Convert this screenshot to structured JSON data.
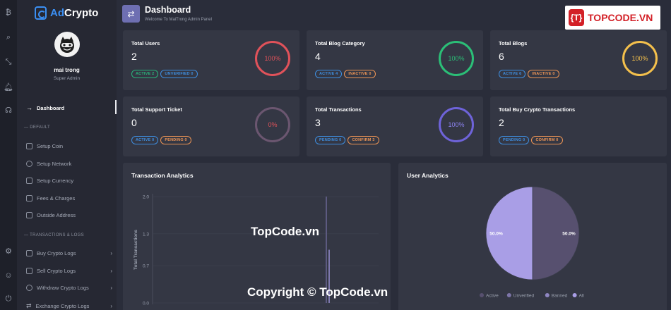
{
  "app": {
    "brand_prefix": "Ad",
    "brand_suffix": "Crypto"
  },
  "user": {
    "name": "mai trong",
    "role": "Super Admin"
  },
  "iconbar": [
    "crypto-icon",
    "search-icon",
    "compress-icon",
    "bell-icon",
    "headset-icon",
    "settings-icon",
    "user-icon",
    "power-icon"
  ],
  "nav": {
    "dashboard": "Dashboard",
    "section_default": "— DEFAULT",
    "default_items": [
      "Setup Coin",
      "Setup Network",
      "Setup Currency",
      "Fees & Charges",
      "Outside Address"
    ],
    "section_transactions": "— TRANSACTIONS & LOGS",
    "transaction_items": [
      "Buy Crypto Logs",
      "Sell Crypto Logs",
      "Withdraw Crypto Logs",
      "Exchange Crypto Logs"
    ]
  },
  "header": {
    "title": "Dashboard",
    "subtitle": "Welcome To MaiTrong Admin Panel"
  },
  "watermark": {
    "badge": "{T}",
    "text": "TOPCODE.VN",
    "center": "TopCode.vn",
    "bottom": "Copyright © TopCode.vn"
  },
  "cards": [
    {
      "title": "Total Users",
      "value": "2",
      "badges": [
        {
          "label": "ACTIVE 2",
          "style": "g"
        },
        {
          "label": "UNVERIFIED 0",
          "style": "b"
        }
      ],
      "ring": "100%",
      "ring_color": "#e0525a"
    },
    {
      "title": "Total Blog Category",
      "value": "4",
      "badges": [
        {
          "label": "ACTIVE 4",
          "style": "b"
        },
        {
          "label": "INACTIVE 0",
          "style": "o"
        }
      ],
      "ring": "100%",
      "ring_color": "#2bbf77"
    },
    {
      "title": "Total Blogs",
      "value": "6",
      "badges": [
        {
          "label": "ACTIVE 6",
          "style": "b"
        },
        {
          "label": "INACTIVE 0",
          "style": "o"
        }
      ],
      "ring": "100%",
      "ring_color": "#f4c04c"
    },
    {
      "title": "Total Support Ticket",
      "value": "0",
      "badges": [
        {
          "label": "ACTIVE 0",
          "style": "b"
        },
        {
          "label": "PENDING 0",
          "style": "o"
        }
      ],
      "ring": "0%",
      "ring_color": "#6b5670"
    },
    {
      "title": "Total Transactions",
      "value": "3",
      "badges": [
        {
          "label": "PENDING 0",
          "style": "b"
        },
        {
          "label": "CONFIRM 3",
          "style": "o"
        }
      ],
      "ring": "100%",
      "ring_color": "#6e63d9"
    },
    {
      "title": "Total Buy Crypto Transactions",
      "value": "2",
      "badges": [
        {
          "label": "PENDING 0",
          "style": "b"
        },
        {
          "label": "CONFIRM 0",
          "style": "o"
        }
      ],
      "ring": "",
      "ring_color": ""
    }
  ],
  "transaction_panel": {
    "title": "Transaction Analytics"
  },
  "user_panel": {
    "title": "User Analytics"
  },
  "chart_data": [
    {
      "type": "bar",
      "title": "Transaction Analytics",
      "ylabel": "Total Transactions",
      "xlabel": "",
      "ylim": [
        0,
        2.0
      ],
      "yticks": [
        "2.0",
        "1.3",
        "0.7",
        "0.0"
      ],
      "values": [
        2.0,
        1.0
      ],
      "colors": [
        "#5c5a80",
        "#7d78ad"
      ]
    },
    {
      "type": "pie",
      "title": "User Analytics",
      "categories": [
        "Active",
        "Unverified",
        "Banned",
        "All"
      ],
      "legend_colors": [
        "#57506f",
        "#7d75a8",
        "#8f86c2",
        "#a99ee6"
      ],
      "slices": [
        {
          "label": "Active",
          "value": 50.0,
          "display": "50.0%",
          "color": "#57506f"
        },
        {
          "label": "All",
          "value": 50.0,
          "display": "50.0%",
          "color": "#a99ee6"
        }
      ],
      "legend": "bottom"
    }
  ]
}
